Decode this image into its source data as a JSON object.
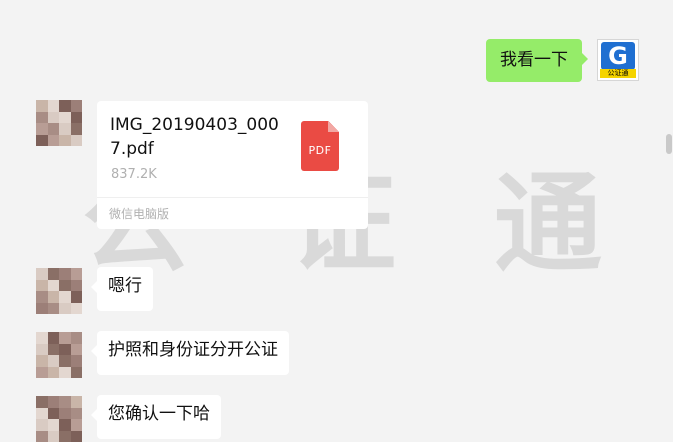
{
  "watermark": {
    "chars": [
      "公",
      "证",
      "通"
    ]
  },
  "self_avatar": {
    "letter": "G",
    "tag": "公证通",
    "brand_color": "#1f6fd1",
    "tag_color": "#f5d400"
  },
  "messages": {
    "self_text": "我看一下",
    "file": {
      "name": "IMG_20190403_0007.pdf",
      "size": "837.2K",
      "source": "微信电脑版",
      "icon_label": "PDF"
    },
    "text_1": "嗯行",
    "text_2": "护照和身份证分开公证",
    "text_3": "您确认一下哈"
  },
  "colors": {
    "self_bubble": "#95ec69",
    "other_bubble": "#ffffff",
    "background": "#f3f3f3",
    "pdf_red": "#ea4b44"
  }
}
